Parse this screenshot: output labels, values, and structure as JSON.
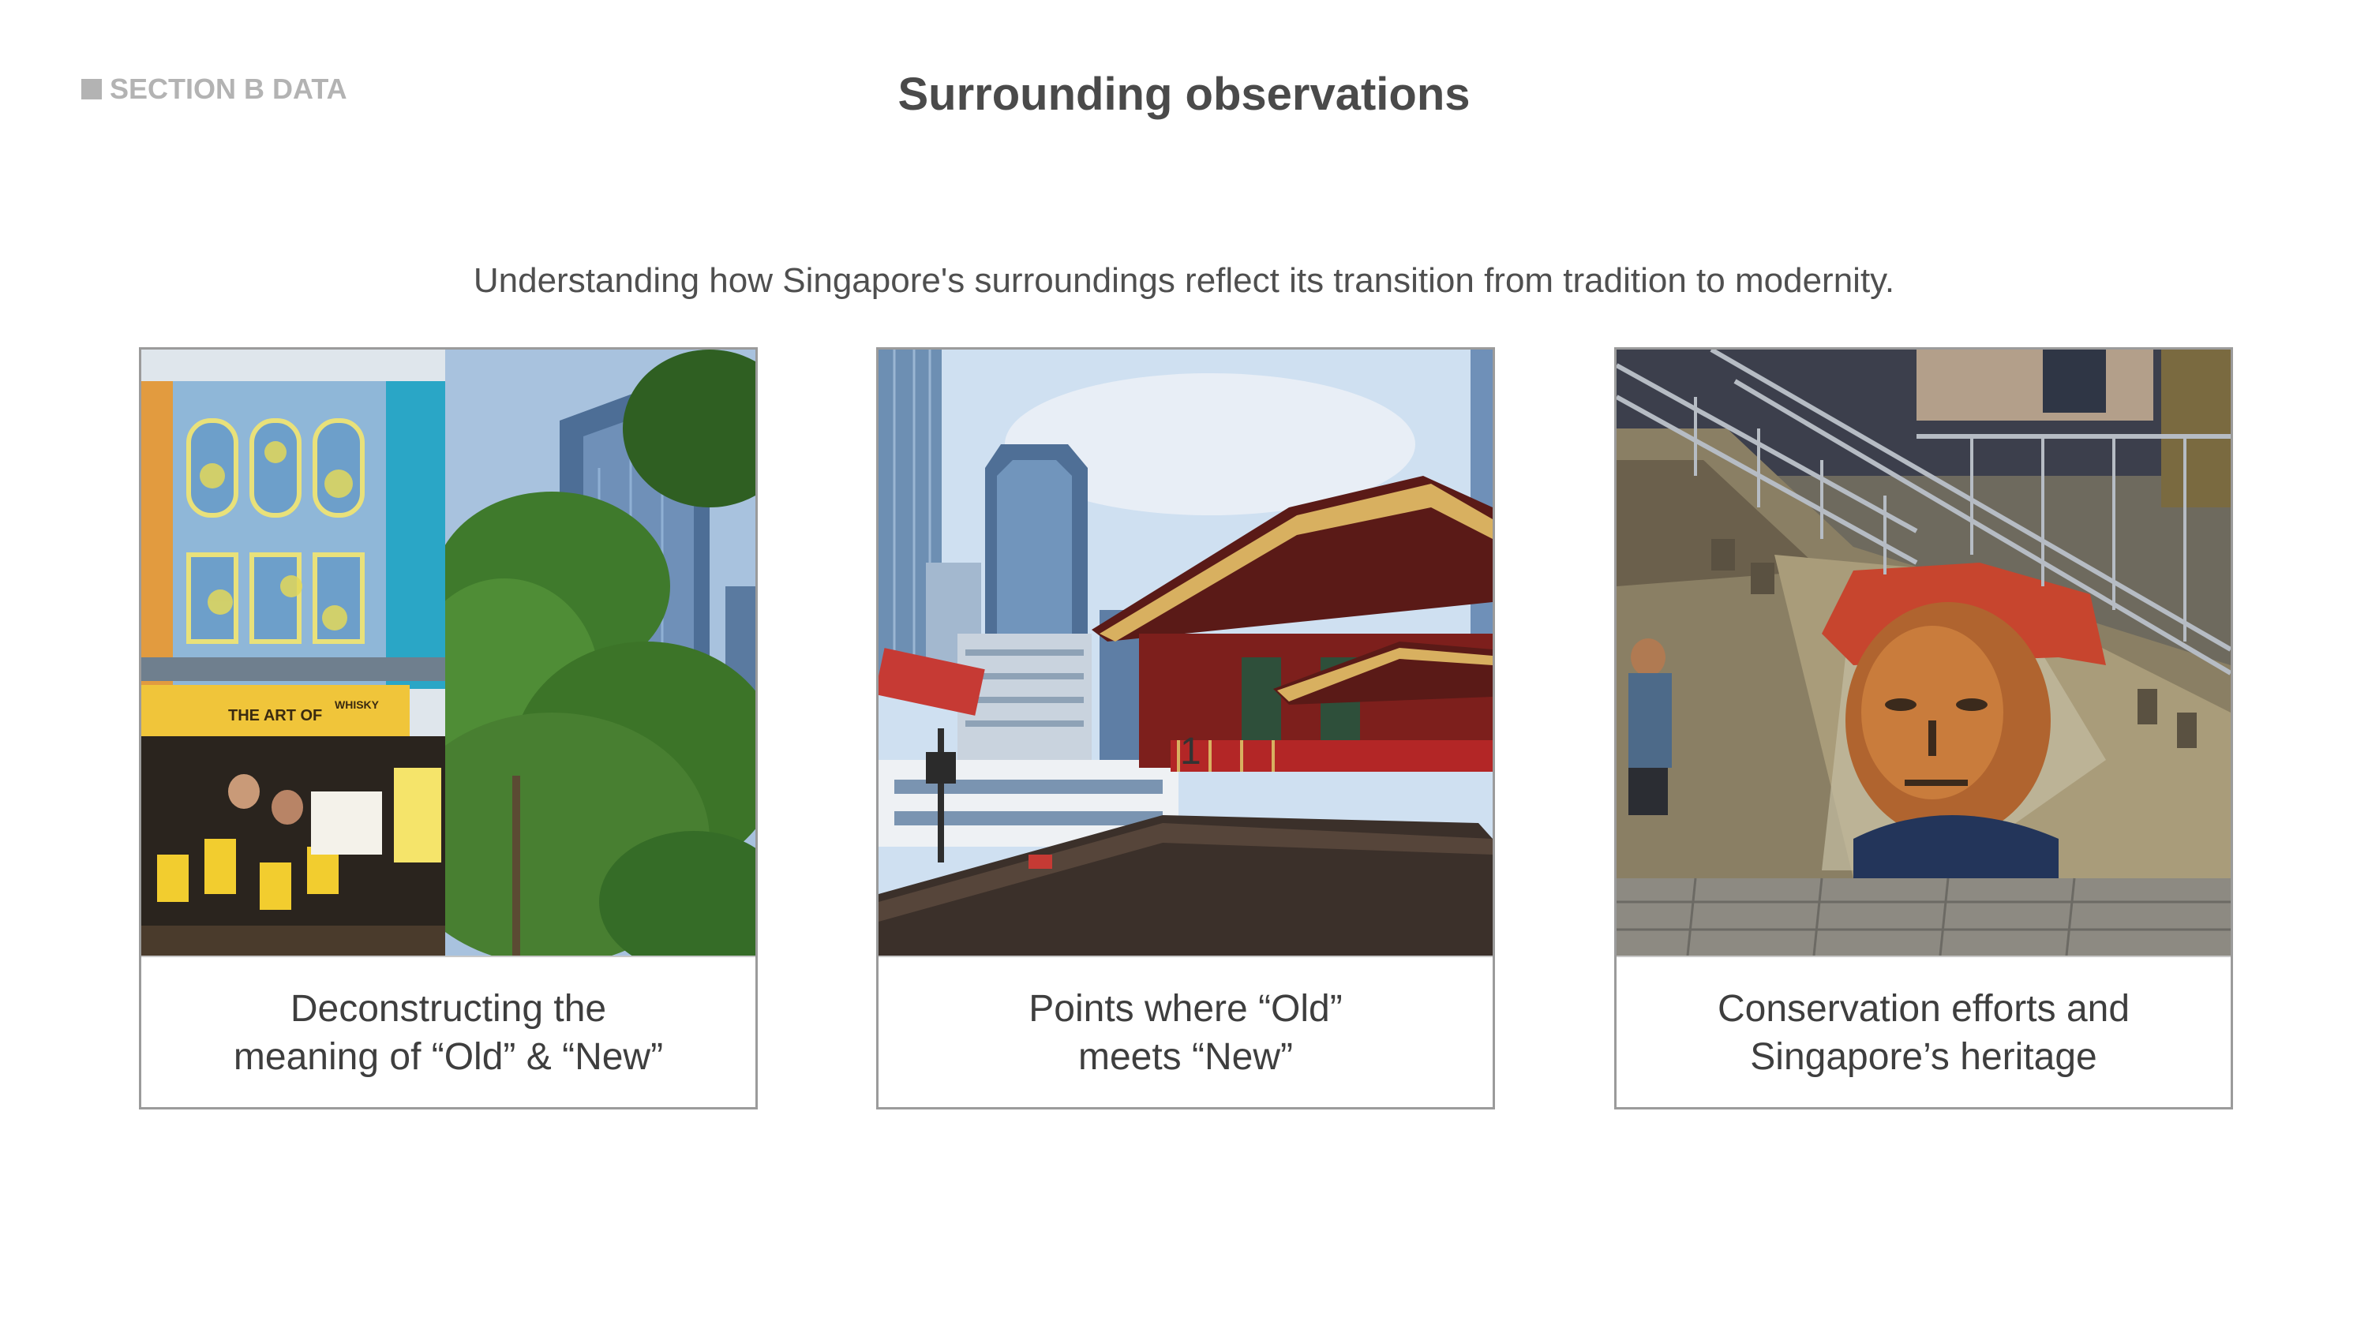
{
  "header": {
    "section_tag": "SECTION B DATA",
    "title": "Surrounding observations"
  },
  "subtitle": "Understanding how Singapore's surroundings reflect its transition from tradition to modernity.",
  "cards": [
    {
      "caption": "Deconstructing the\nmeaning of “Old” & “New”",
      "photo_sign_1": "THE ART OF",
      "photo_sign_2": "WHISKY"
    },
    {
      "caption": "Points where “Old”\nmeets “New”",
      "photo_number": "1"
    },
    {
      "caption": "Conservation efforts and\nSingapore’s heritage"
    }
  ],
  "colors": {
    "tag_gray": "#b3b3b3",
    "title_gray": "#4a4a4a",
    "card_border": "#9b9b9b"
  }
}
